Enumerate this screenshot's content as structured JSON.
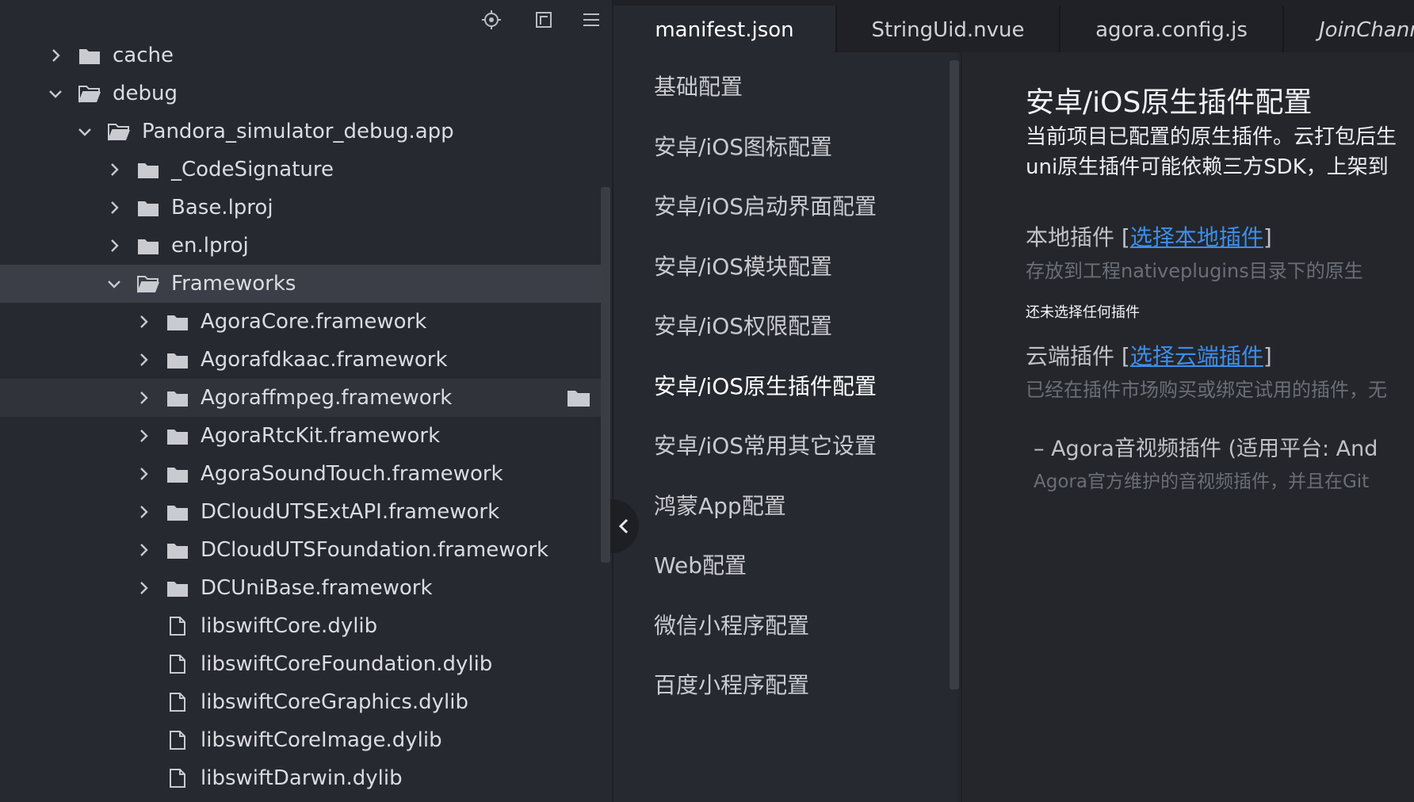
{
  "explorer": {
    "toolbar": [
      "locate-icon",
      "collapse-all-icon",
      "menu-icon"
    ],
    "items": [
      {
        "label": "cache",
        "depth": 0,
        "kind": "folder",
        "expanded": false
      },
      {
        "label": "debug",
        "depth": 0,
        "kind": "folder",
        "expanded": true
      },
      {
        "label": "Pandora_simulator_debug.app",
        "depth": 1,
        "kind": "folder",
        "expanded": true
      },
      {
        "label": "_CodeSignature",
        "depth": 2,
        "kind": "folder",
        "expanded": false
      },
      {
        "label": "Base.lproj",
        "depth": 2,
        "kind": "folder",
        "expanded": false
      },
      {
        "label": "en.lproj",
        "depth": 2,
        "kind": "folder",
        "expanded": false
      },
      {
        "label": "Frameworks",
        "depth": 2,
        "kind": "folder",
        "expanded": true,
        "selected": true
      },
      {
        "label": "AgoraCore.framework",
        "depth": 3,
        "kind": "folder",
        "expanded": false
      },
      {
        "label": "Agorafdkaac.framework",
        "depth": 3,
        "kind": "folder",
        "expanded": false
      },
      {
        "label": "Agoraffmpeg.framework",
        "depth": 3,
        "kind": "folder",
        "expanded": false,
        "hovered": true
      },
      {
        "label": "AgoraRtcKit.framework",
        "depth": 3,
        "kind": "folder",
        "expanded": false
      },
      {
        "label": "AgoraSoundTouch.framework",
        "depth": 3,
        "kind": "folder",
        "expanded": false
      },
      {
        "label": "DCloudUTSExtAPI.framework",
        "depth": 3,
        "kind": "folder",
        "expanded": false
      },
      {
        "label": "DCloudUTSFoundation.framework",
        "depth": 3,
        "kind": "folder",
        "expanded": false
      },
      {
        "label": "DCUniBase.framework",
        "depth": 3,
        "kind": "folder",
        "expanded": false
      },
      {
        "label": "libswiftCore.dylib",
        "depth": 3,
        "kind": "file"
      },
      {
        "label": "libswiftCoreFoundation.dylib",
        "depth": 3,
        "kind": "file"
      },
      {
        "label": "libswiftCoreGraphics.dylib",
        "depth": 3,
        "kind": "file"
      },
      {
        "label": "libswiftCoreImage.dylib",
        "depth": 3,
        "kind": "file"
      },
      {
        "label": "libswiftDarwin.dylib",
        "depth": 3,
        "kind": "file"
      }
    ]
  },
  "tabs": [
    {
      "label": "manifest.json",
      "active": true
    },
    {
      "label": "StringUid.nvue",
      "active": false
    },
    {
      "label": "agora.config.js",
      "active": false
    },
    {
      "label": "JoinChann",
      "active": false,
      "italic": true
    }
  ],
  "settings_nav": [
    {
      "label": "基础配置",
      "active": false
    },
    {
      "label": "安卓/iOS图标配置",
      "active": false
    },
    {
      "label": "安卓/iOS启动界面配置",
      "active": false
    },
    {
      "label": "安卓/iOS模块配置",
      "active": false
    },
    {
      "label": "安卓/iOS权限配置",
      "active": false
    },
    {
      "label": "安卓/iOS原生插件配置",
      "active": true
    },
    {
      "label": "安卓/iOS常用其它设置",
      "active": false
    },
    {
      "label": "鸿蒙App配置",
      "active": false
    },
    {
      "label": "Web配置",
      "active": false
    },
    {
      "label": "微信小程序配置",
      "active": false
    },
    {
      "label": "百度小程序配置",
      "active": false
    }
  ],
  "content": {
    "title": "安卓/iOS原生插件配置",
    "desc1": "当前项目已配置的原生插件。云打包后生",
    "desc2": "uni原生插件可能依赖三方SDK，上架到",
    "local": {
      "label": "本地插件",
      "link": "选择本地插件",
      "hint": "存放到工程nativeplugins目录下的原生",
      "empty": "还未选择任何插件"
    },
    "cloud": {
      "label": "云端插件",
      "link": "选择云端插件",
      "hint": "已经在插件市场购买或绑定试用的插件，无"
    },
    "plugin": {
      "name": "– Agora音视频插件 (适用平台: And",
      "desc": "Agora官方维护的音视频插件，并且在Git"
    }
  },
  "colors": {
    "link": "#3d8ee9",
    "selected_row": "#3b3e46",
    "panel_bg": "#272930"
  }
}
